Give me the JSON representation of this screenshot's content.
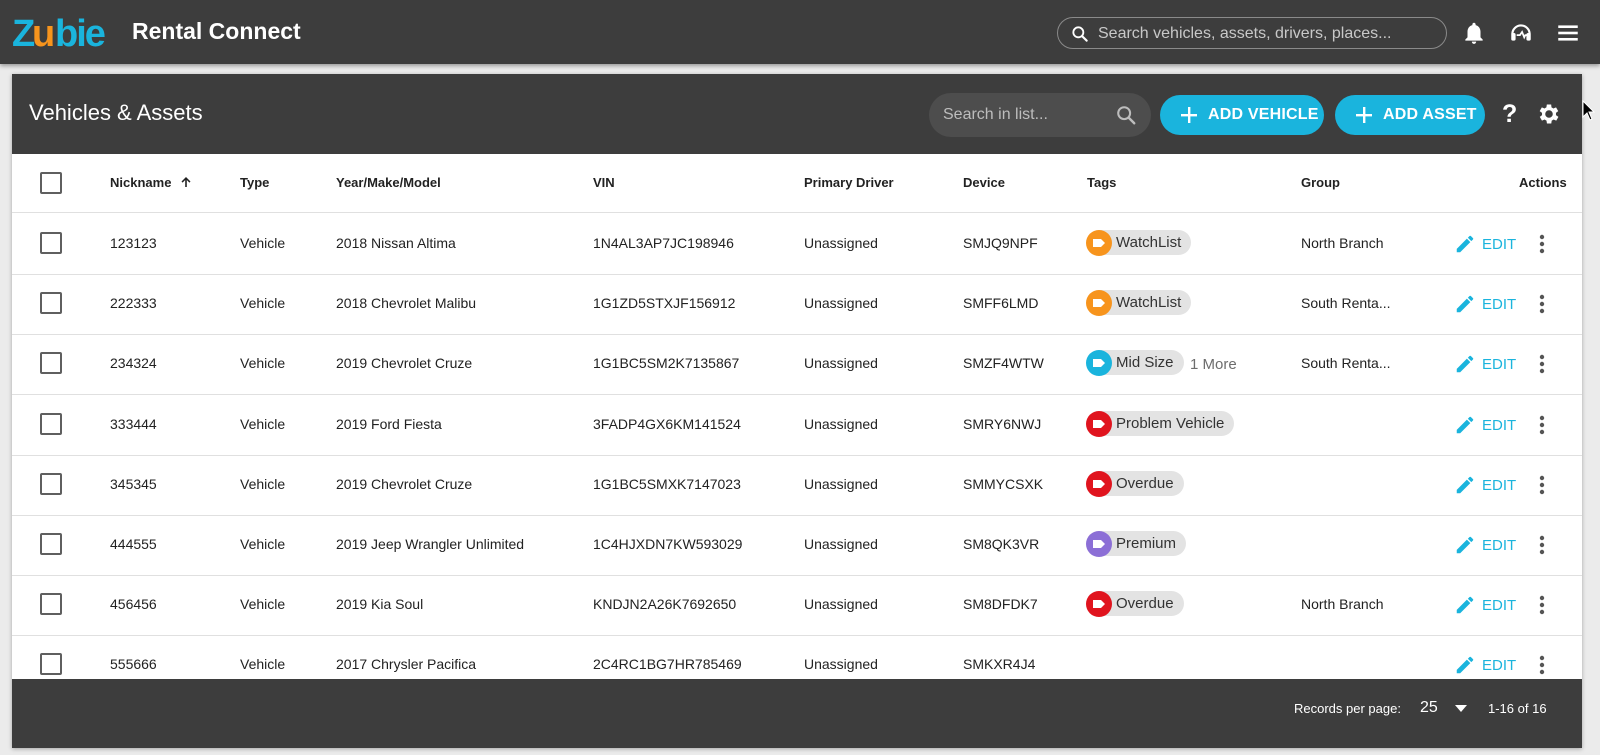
{
  "app": {
    "logo_text": "Zubie",
    "title": "Rental Connect",
    "search_placeholder": "Search vehicles, assets, drivers, places..."
  },
  "panel": {
    "title": "Vehicles & Assets",
    "search_placeholder": "Search in list...",
    "add_vehicle_label": "ADD VEHICLE",
    "add_asset_label": "ADD ASSET",
    "help_label": "?"
  },
  "table": {
    "columns": {
      "nickname": "Nickname",
      "type": "Type",
      "ymm": "Year/Make/Model",
      "vin": "VIN",
      "driver": "Primary Driver",
      "device": "Device",
      "tags": "Tags",
      "group": "Group",
      "actions": "Actions"
    },
    "edit_label": "EDIT",
    "rows": [
      {
        "nickname": "123123",
        "type": "Vehicle",
        "ymm": "2018 Nissan Altima",
        "vin": "1N4AL3AP7JC198946",
        "driver": "Unassigned",
        "device": "SMJQ9NPF",
        "tag": "WatchList",
        "tag_color": "#f7941d",
        "more": "",
        "group": "North Branch"
      },
      {
        "nickname": "222333",
        "type": "Vehicle",
        "ymm": "2018 Chevrolet Malibu",
        "vin": "1G1ZD5STXJF156912",
        "driver": "Unassigned",
        "device": "SMFF6LMD",
        "tag": "WatchList",
        "tag_color": "#f7941d",
        "more": "",
        "group": "South Renta..."
      },
      {
        "nickname": "234324",
        "type": "Vehicle",
        "ymm": "2019 Chevrolet Cruze",
        "vin": "1G1BC5SM2K7135867",
        "driver": "Unassigned",
        "device": "SMZF4WTW",
        "tag": "Mid Size",
        "tag_color": "#1ab4dd",
        "more": "1 More",
        "group": "South Renta..."
      },
      {
        "nickname": "333444",
        "type": "Vehicle",
        "ymm": "2019 Ford Fiesta",
        "vin": "3FADP4GX6KM141524",
        "driver": "Unassigned",
        "device": "SMRY6NWJ",
        "tag": "Problem Vehicle",
        "tag_color": "#e0141e",
        "more": "",
        "group": ""
      },
      {
        "nickname": "345345",
        "type": "Vehicle",
        "ymm": "2019 Chevrolet Cruze",
        "vin": "1G1BC5SMXK7147023",
        "driver": "Unassigned",
        "device": "SMMYCSXK",
        "tag": "Overdue",
        "tag_color": "#e0141e",
        "more": "",
        "group": ""
      },
      {
        "nickname": "444555",
        "type": "Vehicle",
        "ymm": "2019 Jeep Wrangler Unlimited",
        "vin": "1C4HJXDN7KW593029",
        "driver": "Unassigned",
        "device": "SM8QK3VR",
        "tag": "Premium",
        "tag_color": "#8c6fd6",
        "more": "",
        "group": ""
      },
      {
        "nickname": "456456",
        "type": "Vehicle",
        "ymm": "2019 Kia Soul",
        "vin": "KNDJN2A26K7692650",
        "driver": "Unassigned",
        "device": "SM8DFDK7",
        "tag": "Overdue",
        "tag_color": "#e0141e",
        "more": "",
        "group": "North Branch"
      },
      {
        "nickname": "555666",
        "type": "Vehicle",
        "ymm": "2017 Chrysler Pacifica",
        "vin": "2C4RC1BG7HR785469",
        "driver": "Unassigned",
        "device": "SMKXR4J4",
        "tag": "",
        "tag_color": "",
        "more": "",
        "group": ""
      }
    ]
  },
  "footer": {
    "records_label": "Records per page:",
    "records_value": "25",
    "range": "1-16 of 16"
  },
  "colors": {
    "accent": "#1ab4dd",
    "bar": "#3d3d3d"
  }
}
